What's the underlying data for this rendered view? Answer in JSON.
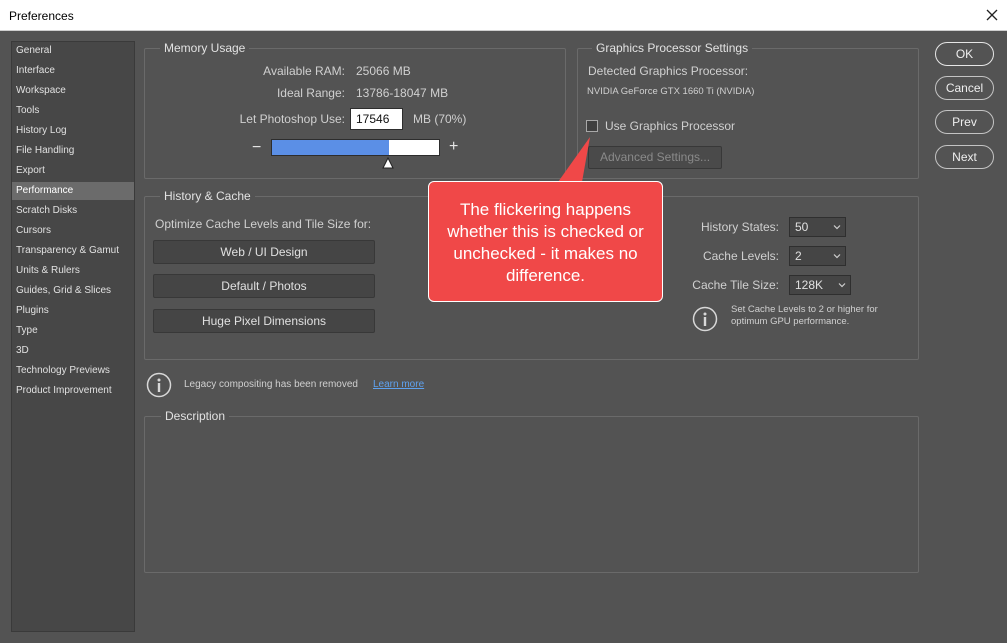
{
  "window": {
    "title": "Preferences"
  },
  "sidebar": {
    "items": [
      {
        "label": "General"
      },
      {
        "label": "Interface"
      },
      {
        "label": "Workspace"
      },
      {
        "label": "Tools"
      },
      {
        "label": "History Log"
      },
      {
        "label": "File Handling"
      },
      {
        "label": "Export"
      },
      {
        "label": "Performance"
      },
      {
        "label": "Scratch Disks"
      },
      {
        "label": "Cursors"
      },
      {
        "label": "Transparency & Gamut"
      },
      {
        "label": "Units & Rulers"
      },
      {
        "label": "Guides, Grid & Slices"
      },
      {
        "label": "Plugins"
      },
      {
        "label": "Type"
      },
      {
        "label": "3D"
      },
      {
        "label": "Technology Previews"
      },
      {
        "label": "Product Improvement"
      }
    ],
    "active": "Performance"
  },
  "memory": {
    "group_label": "Memory Usage",
    "available_label": "Available RAM:",
    "available_value": "25066 MB",
    "ideal_label": "Ideal Range:",
    "ideal_value": "13786-18047 MB",
    "let_use_label": "Let Photoshop Use:",
    "let_use_value": "17546",
    "let_use_suffix": "MB (70%)",
    "minus": "−",
    "plus": "+",
    "slider_fraction": 0.7
  },
  "gpu": {
    "group_label": "Graphics Processor Settings",
    "detected_label": "Detected Graphics Processor:",
    "detected_value": "NVIDIA GeForce GTX 1660 Ti (NVIDIA)",
    "use_gpu_label": "Use Graphics Processor",
    "use_gpu_checked": false,
    "advanced_button": "Advanced Settings..."
  },
  "history_cache": {
    "group_label": "History & Cache",
    "optimize_label": "Optimize Cache Levels and Tile Size for:",
    "btn_web": "Web / UI Design",
    "btn_default": "Default / Photos",
    "btn_huge": "Huge Pixel Dimensions",
    "history_states_label": "History States:",
    "history_states_value": "50",
    "cache_levels_label": "Cache Levels:",
    "cache_levels_value": "2",
    "tile_size_label": "Cache Tile Size:",
    "tile_size_value": "128K",
    "tip_line1": "Set Cache Levels to 2 or higher for",
    "tip_line2": "optimum GPU performance."
  },
  "legacy": {
    "text": "Legacy compositing has been removed",
    "link": "Learn more"
  },
  "description": {
    "group_label": "Description"
  },
  "buttons": {
    "ok": "OK",
    "cancel": "Cancel",
    "prev": "Prev",
    "next": "Next"
  },
  "callout": {
    "text": "The flickering happens whether this is checked or unchecked - it makes no difference.",
    "color": "#f04848"
  },
  "colors": {
    "panel": "#535353",
    "sidebar": "#474747",
    "accent": "#5b8fe6",
    "link": "#5ea2f0"
  }
}
